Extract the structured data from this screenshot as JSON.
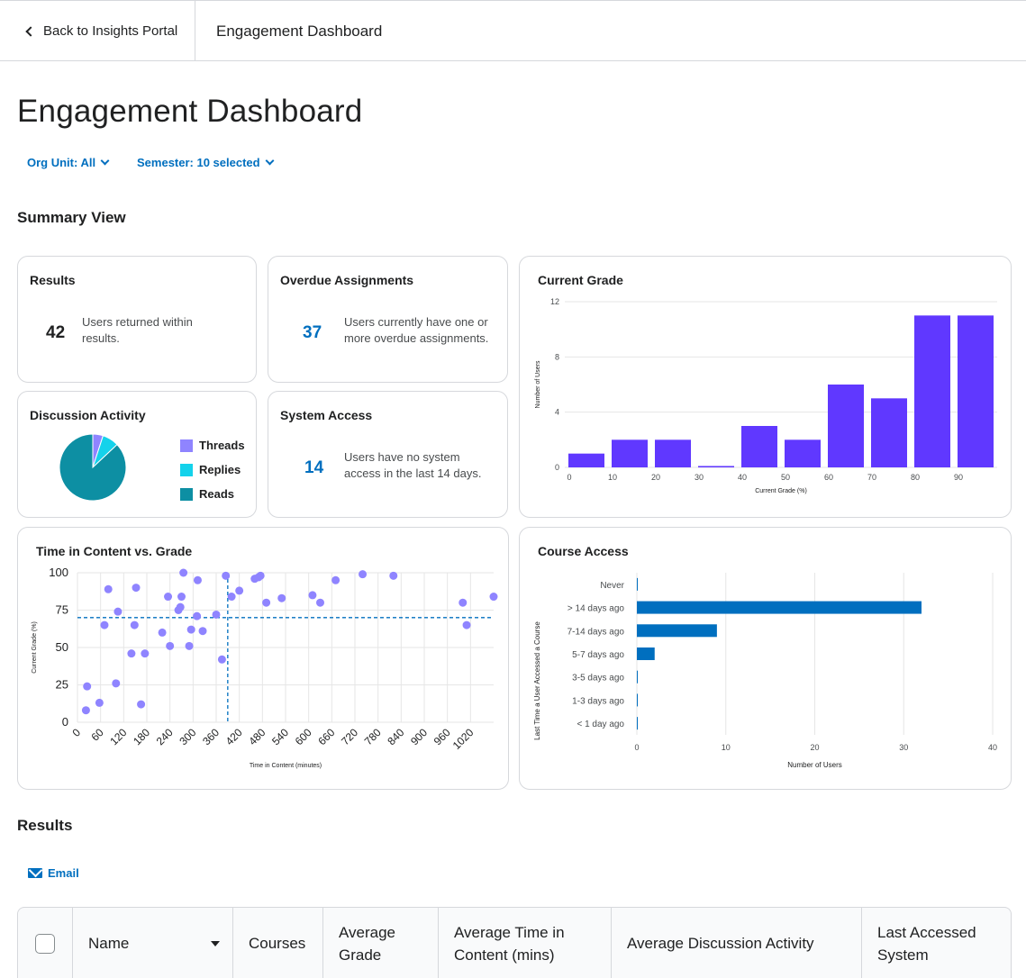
{
  "nav": {
    "back_label": "Back to Insights Portal",
    "crumb_title": "Engagement Dashboard"
  },
  "page_title": "Engagement Dashboard",
  "filters": {
    "org_unit": "Org Unit: All",
    "semester": "Semester: 10 selected"
  },
  "summary_heading": "Summary View",
  "cards": {
    "results": {
      "title": "Results",
      "value": "42",
      "desc_1": "Users returned within",
      "desc_2": "results."
    },
    "overdue": {
      "title": "Overdue Assignments",
      "value": "37",
      "desc_1": "Users currently have one or",
      "desc_2": "more overdue assignments."
    },
    "discussion": {
      "title": "Discussion Activity",
      "legend": [
        {
          "label": "Threads",
          "color": "#8f84ff"
        },
        {
          "label": "Replies",
          "color": "#14d2eb"
        },
        {
          "label": "Reads",
          "color": "#0d8fa3"
        }
      ],
      "slices": [
        0.05,
        0.08,
        0.87
      ]
    },
    "system_access": {
      "title": "System Access",
      "value": "14",
      "desc_1": "Users have no system",
      "desc_2": "access in the last 14 days."
    },
    "current_grade": {
      "title": "Current Grade"
    },
    "time_vs_grade": {
      "title": "Time in Content vs. Grade"
    },
    "course_access": {
      "title": "Course Access"
    }
  },
  "chart_data": [
    {
      "type": "bar",
      "title": "Current Grade",
      "xlabel": "Current Grade (%)",
      "ylabel": "Number of Users",
      "x_ticks": [
        "0",
        "10",
        "20",
        "30",
        "40",
        "50",
        "60",
        "70",
        "80",
        "90"
      ],
      "y_ticks": [
        "0",
        "4",
        "8",
        "12"
      ],
      "ylim": [
        0,
        12
      ],
      "bins": [
        {
          "from": 0,
          "to": 10,
          "value": 1
        },
        {
          "from": 10,
          "to": 20,
          "value": 2
        },
        {
          "from": 20,
          "to": 30,
          "value": 2
        },
        {
          "from": 30,
          "to": 40,
          "value": 0.1
        },
        {
          "from": 40,
          "to": 50,
          "value": 3
        },
        {
          "from": 50,
          "to": 60,
          "value": 2
        },
        {
          "from": 60,
          "to": 70,
          "value": 6
        },
        {
          "from": 70,
          "to": 80,
          "value": 5
        },
        {
          "from": 80,
          "to": 90,
          "value": 11
        },
        {
          "from": 90,
          "to": 100,
          "value": 11
        }
      ],
      "color": "#6038ff",
      "grid": true
    },
    {
      "type": "scatter",
      "title": "Time in Content vs. Grade",
      "xlabel": "Time in Content (minutes)",
      "ylabel": "Current Grade (%)",
      "x_ticks": [
        "0",
        "60",
        "120",
        "180",
        "240",
        "300",
        "360",
        "420",
        "480",
        "540",
        "600",
        "660",
        "720",
        "780",
        "840",
        "900",
        "960",
        "1020"
      ],
      "y_ticks": [
        "0",
        "25",
        "50",
        "75",
        "100"
      ],
      "xlim": [
        0,
        1080
      ],
      "ylim": [
        0,
        100
      ],
      "threshold_x": 390,
      "threshold_y": 70,
      "color": "#8f84ff",
      "points": [
        [
          22,
          8
        ],
        [
          25,
          24
        ],
        [
          57,
          13
        ],
        [
          70,
          65
        ],
        [
          80,
          89
        ],
        [
          100,
          26
        ],
        [
          105,
          74
        ],
        [
          140,
          46
        ],
        [
          148,
          65
        ],
        [
          152,
          90
        ],
        [
          165,
          12
        ],
        [
          175,
          46
        ],
        [
          220,
          60
        ],
        [
          235,
          84
        ],
        [
          240,
          51
        ],
        [
          262,
          75
        ],
        [
          267,
          77
        ],
        [
          270,
          84
        ],
        [
          275,
          100
        ],
        [
          290,
          51
        ],
        [
          295,
          62
        ],
        [
          310,
          71
        ],
        [
          312,
          95
        ],
        [
          325,
          61
        ],
        [
          360,
          72
        ],
        [
          375,
          42
        ],
        [
          385,
          98
        ],
        [
          400,
          84
        ],
        [
          420,
          88
        ],
        [
          460,
          96
        ],
        [
          470,
          97
        ],
        [
          475,
          98
        ],
        [
          490,
          80
        ],
        [
          530,
          83
        ],
        [
          610,
          85
        ],
        [
          630,
          80
        ],
        [
          670,
          95
        ],
        [
          740,
          99
        ],
        [
          820,
          98
        ],
        [
          1000,
          80
        ],
        [
          1010,
          65
        ],
        [
          1080,
          84
        ]
      ],
      "grid": true
    },
    {
      "type": "bar",
      "orientation": "horizontal",
      "title": "Course Access",
      "xlabel": "Number of Users",
      "ylabel": "Last Time a User Accessed a Course",
      "categories": [
        "Never",
        "> 14 days ago",
        "7-14 days ago",
        "5-7 days ago",
        "3-5 days ago",
        "1-3 days ago",
        "< 1 day ago"
      ],
      "values": [
        0.1,
        32,
        9,
        2,
        0.1,
        0.1,
        0.1
      ],
      "x_ticks": [
        "0",
        "10",
        "20",
        "30",
        "40"
      ],
      "xlim": [
        0,
        40
      ],
      "color": "#006fbf",
      "grid": true
    }
  ],
  "results_heading": "Results",
  "email_label": "Email",
  "table": {
    "col_name": "Name",
    "col_courses": "Courses",
    "col_avg_grade_1": "Average",
    "col_avg_grade_2": "Grade",
    "col_avg_time_1": "Average Time in",
    "col_avg_time_2": "Content (mins)",
    "col_discussion": "Average Discussion Activity",
    "col_last_access_1": "Last Accessed",
    "col_last_access_2": "System"
  }
}
